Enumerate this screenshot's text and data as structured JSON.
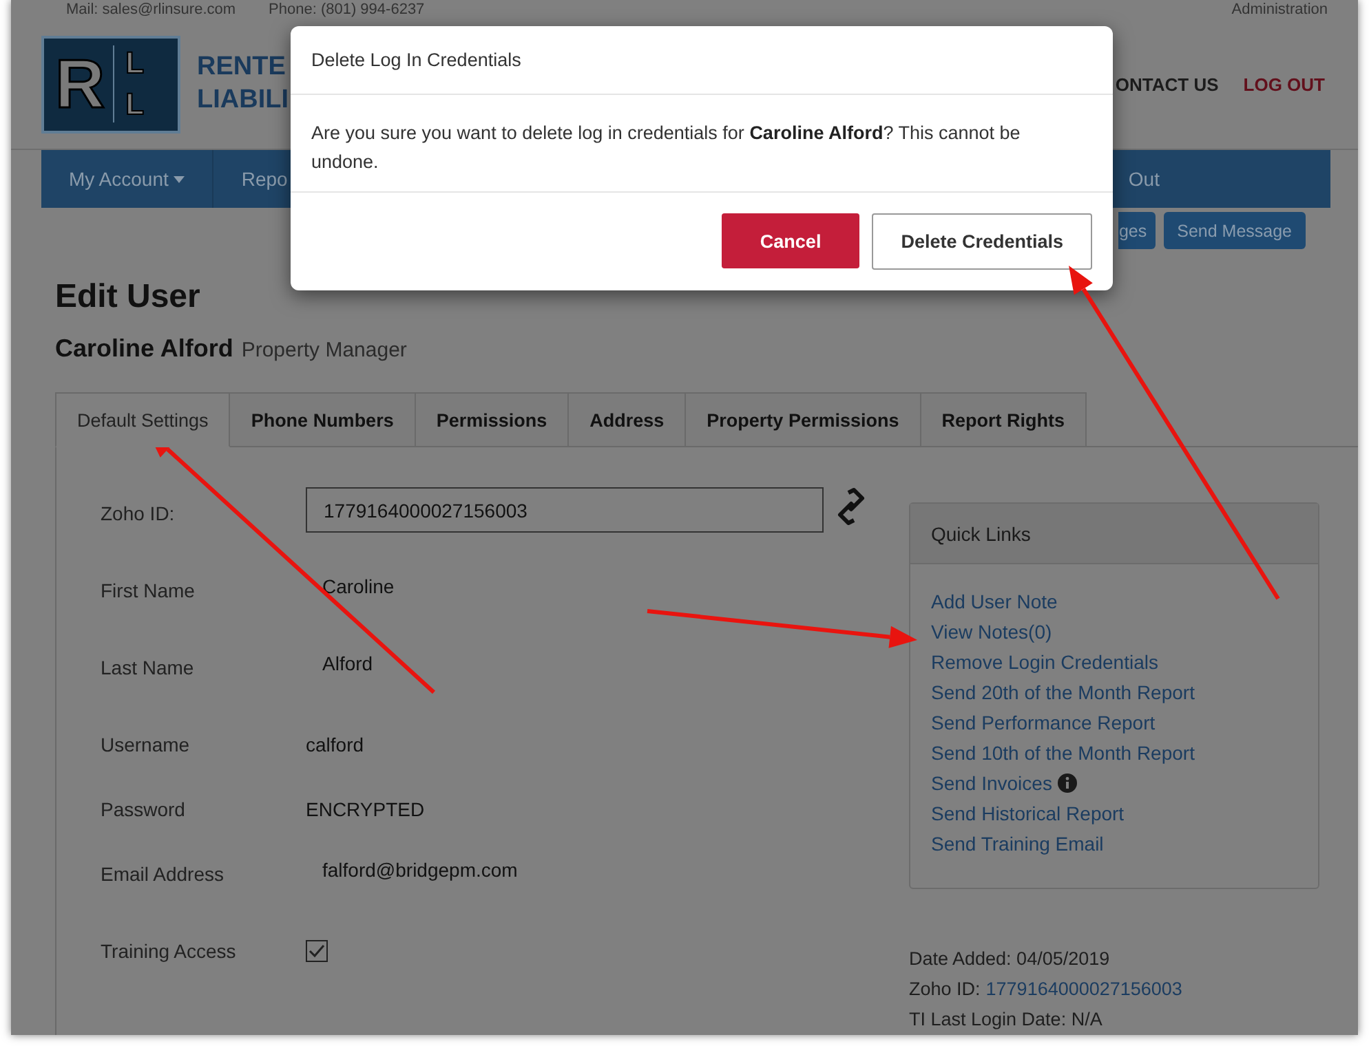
{
  "top_bar": {
    "mail": "Mail: sales@rlinsure.com",
    "phone": "Phone: (801) 994-6237",
    "admin": "Administration"
  },
  "logo": {
    "letters": [
      "R",
      "L",
      "L"
    ],
    "lines": [
      "RENTE",
      "LIABILI"
    ]
  },
  "header_links": [
    {
      "label": "ONTACT US",
      "kind": "normal"
    },
    {
      "label": "LOG OUT",
      "kind": "danger"
    }
  ],
  "nav": [
    {
      "label": "My Account",
      "dropdown": true
    },
    {
      "label": "Repo",
      "dropdown": false
    },
    {
      "label": "Out",
      "dropdown": false
    }
  ],
  "action_buttons": [
    "ges",
    "Send Message"
  ],
  "page_title": "Edit User",
  "user": {
    "name": "Caroline Alford",
    "role": "Property Manager"
  },
  "tabs": [
    {
      "label": "Default Settings",
      "selected": true
    },
    {
      "label": "Phone Numbers",
      "selected": false
    },
    {
      "label": "Permissions",
      "selected": false
    },
    {
      "label": "Address",
      "selected": false
    },
    {
      "label": "Property Permissions",
      "selected": false
    },
    {
      "label": "Report Rights",
      "selected": false
    }
  ],
  "fields": [
    {
      "label": "Zoho ID:",
      "kind": "input",
      "value": "1779164000027156003"
    },
    {
      "label": "First Name",
      "kind": "plain-input",
      "value": "Caroline"
    },
    {
      "label": "Last Name",
      "kind": "plain-input",
      "value": "Alford"
    },
    {
      "label": "Username",
      "kind": "text",
      "value": "calford"
    },
    {
      "label": "Password",
      "kind": "text",
      "value": "ENCRYPTED"
    },
    {
      "label": "Email Address",
      "kind": "plain-input",
      "value": "falford@bridgepm.com"
    },
    {
      "label": "Training Access",
      "kind": "checkbox",
      "checked": true
    }
  ],
  "quick_links": {
    "title": "Quick Links",
    "links": [
      {
        "label": "Add User Note",
        "info": false
      },
      {
        "label": "View Notes(0)",
        "info": false
      },
      {
        "label": "Remove Login Credentials",
        "info": false
      },
      {
        "label": "Send 20th of the Month Report",
        "info": false
      },
      {
        "label": "Send Performance Report",
        "info": false
      },
      {
        "label": "Send 10th of the Month Report",
        "info": false
      },
      {
        "label": "Send Invoices",
        "info": true
      },
      {
        "label": "Send Historical Report",
        "info": false
      },
      {
        "label": "Send Training Email",
        "info": false
      }
    ]
  },
  "details": [
    {
      "text": "Date Added: 04/05/2019"
    },
    {
      "text": "Zoho ID:",
      "link": "1779164000027156003"
    },
    {
      "text": "TI Last Login Date: N/A"
    }
  ],
  "modal": {
    "title": "Delete Log In Credentials",
    "message": "Are you sure you want to delete log in credentials for **Caroline Alford**? This cannot be undone.",
    "buttons": [
      {
        "label": "Cancel",
        "kind": "danger"
      },
      {
        "label": "Delete Credentials",
        "kind": "default"
      }
    ]
  }
}
